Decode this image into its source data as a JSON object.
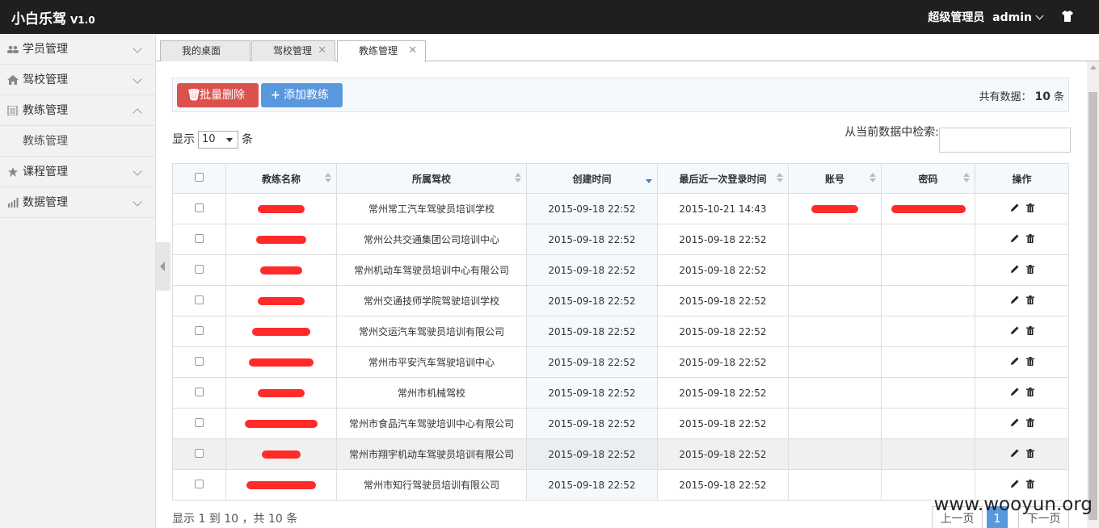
{
  "app": {
    "title": "小白乐驾",
    "version": "V1.0",
    "user_role": "超级管理员",
    "username": "admin"
  },
  "sidebar": {
    "items": [
      {
        "label": "学员管理",
        "icon": "users-icon",
        "expanded": false
      },
      {
        "label": "驾校管理",
        "icon": "home-icon",
        "expanded": false
      },
      {
        "label": "教练管理",
        "icon": "list-icon",
        "expanded": true,
        "sub": "教练管理"
      },
      {
        "label": "课程管理",
        "icon": "star-icon",
        "expanded": false
      },
      {
        "label": "数据管理",
        "icon": "chart-icon",
        "expanded": false
      }
    ]
  },
  "tabs": [
    {
      "label": "我的桌面",
      "closable": false
    },
    {
      "label": "驾校管理",
      "closable": true
    },
    {
      "label": "教练管理",
      "closable": true,
      "active": true
    }
  ],
  "toolbar": {
    "batch_delete": "批量删除",
    "add_coach": "添加教练",
    "total_prefix": "共有数据：",
    "total_count": "10",
    "total_suffix": "条"
  },
  "list": {
    "show_prefix": "显示",
    "page_size": "10",
    "show_suffix": "条",
    "search_label": "从当前数据中检索:",
    "columns": [
      "教练名称",
      "所属驾校",
      "创建时间",
      "最后近一次登录时间",
      "账号",
      "密码",
      "操作"
    ],
    "rows": [
      {
        "school": "常州常工汽车驾驶员培训学校",
        "created": "2015-09-18 22:52",
        "last_login": "2015-10-21 14:43"
      },
      {
        "school": "常州公共交通集团公司培训中心",
        "created": "2015-09-18 22:52",
        "last_login": "2015-09-18 22:52"
      },
      {
        "school": "常州机动车驾驶员培训中心有限公司",
        "created": "2015-09-18 22:52",
        "last_login": "2015-09-18 22:52"
      },
      {
        "school": "常州交通技师学院驾驶培训学校",
        "created": "2015-09-18 22:52",
        "last_login": "2015-09-18 22:52"
      },
      {
        "school": "常州交运汽车驾驶员培训有限公司",
        "created": "2015-09-18 22:52",
        "last_login": "2015-09-18 22:52"
      },
      {
        "school": "常州市平安汽车驾驶培训中心",
        "created": "2015-09-18 22:52",
        "last_login": "2015-09-18 22:52"
      },
      {
        "school": "常州市机械驾校",
        "created": "2015-09-18 22:52",
        "last_login": "2015-09-18 22:52"
      },
      {
        "school": "常州市食品汽车驾驶培训中心有限公司",
        "created": "2015-09-18 22:52",
        "last_login": "2015-09-18 22:52"
      },
      {
        "school": "常州市翔宇机动车驾驶员培训有限公司",
        "created": "2015-09-18 22:52",
        "last_login": "2015-09-18 22:52"
      },
      {
        "school": "常州市知行驾驶员培训有限公司",
        "created": "2015-09-18 22:52",
        "last_login": "2015-09-18 22:52"
      }
    ],
    "info": "显示 1 到 10 ，共 10 条"
  },
  "pager": {
    "prev": "上一页",
    "current": "1",
    "next": "下一页"
  },
  "watermark": "www.wooyun.org",
  "colors": {
    "topbar": "#1f1f1f",
    "danger": "#dd514c",
    "primary": "#5a98de",
    "redaction": "#ff2a2a"
  }
}
